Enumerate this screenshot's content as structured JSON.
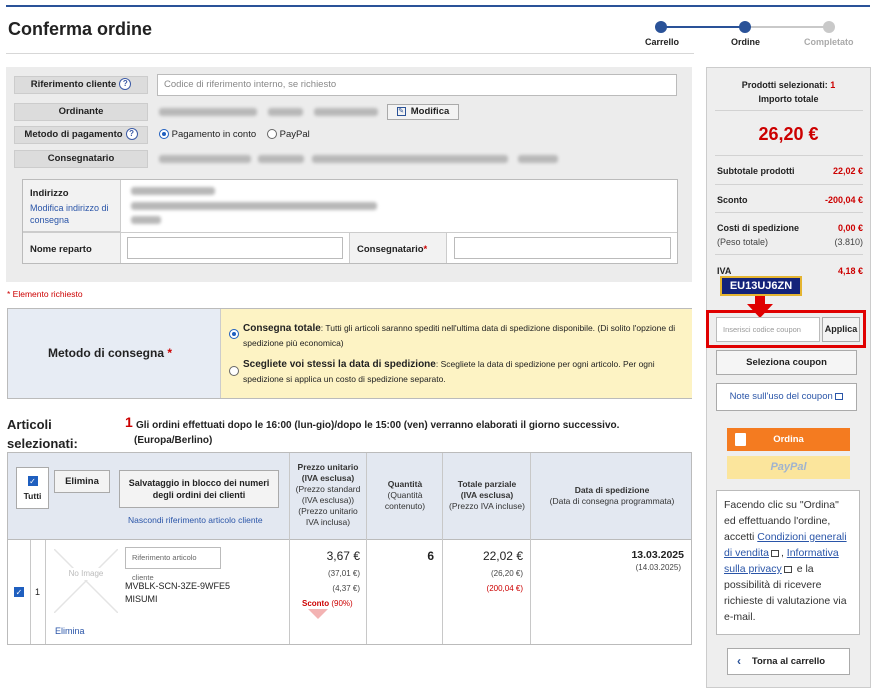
{
  "page": {
    "title": "Conferma ordine"
  },
  "steps": [
    {
      "label": "Carrello",
      "state": "done"
    },
    {
      "label": "Ordine",
      "state": "active"
    },
    {
      "label": "Completato",
      "state": "pending"
    }
  ],
  "form": {
    "customer_ref_label": "Riferimento cliente",
    "customer_ref_placeholder": "Codice di riferimento interno, se richiesto",
    "orderer_label": "Ordinante",
    "modify_label": "Modifica",
    "payment_label": "Metodo di pagamento",
    "payment_options": [
      "Pagamento in conto",
      "PayPal"
    ],
    "consignee_label": "Consegnatario",
    "address_label": "Indirizzo",
    "modify_address_link": "Modifica indirizzo di consegna",
    "department_label": "Nome reparto",
    "consignee_field_label": "Consegnatario",
    "required_mark": "*",
    "required_note": "* Elemento richiesto"
  },
  "delivery": {
    "label": "Metodo di consegna",
    "required_mark": "*",
    "option1_title": "Consegna totale",
    "option1_text": ": Tutti gli articoli saranno spediti nell'ultima data di spedizione disponibile. (Di solito l'opzione di spedizione più economica)",
    "option2_title": "Scegliete voi stessi la data di spedizione",
    "option2_text": ": Scegliete la data di spedizione per ogni articolo. Per ogni spedizione si applica un costo di spedizione separato."
  },
  "articles": {
    "title": "Articoli selezionati:",
    "notice_number": "1",
    "notice_text": "Gli ordini effettuati dopo le 16:00 (lun-gio)/dopo le 15:00 (ven) verranno elaborati il giorno successivo.",
    "notice_tz": "(Europa/Berlino)",
    "all_label": "Tutti",
    "delete_label": "Elimina",
    "bulk_save_label": "Salvataggio in blocco dei numeri degli ordini dei clienti",
    "hide_ref_link": "Nascondi riferimento articolo cliente",
    "headers": {
      "unit_price": "Prezzo unitario",
      "unit_price_sub1": "(IVA esclusa)",
      "unit_price_sub2": "(Prezzo standard (IVA esclusa))",
      "unit_price_sub3": "(Prezzo unitario IVA inclusa)",
      "quantity": "Quantità",
      "quantity_sub": "(Quantità contenuto)",
      "subtotal": "Totale parziale",
      "subtotal_sub1": "(IVA esclusa)",
      "subtotal_sub2": "(Prezzo IVA incluse)",
      "ship_date": "Data di spedizione",
      "ship_date_sub": "(Data di consegna programmata)"
    },
    "row": {
      "index": "1",
      "no_image": "No Image",
      "ref_placeholder": "Riferimento articolo cliente",
      "part_number": "MVBLK-SCN-3ZE-9WFE5",
      "brand": "MISUMI",
      "delete_link": "Elimina",
      "unit_price": "3,67 €",
      "standard_price": "(37,01 €)",
      "price_incl_vat": "(4,37 €)",
      "discount": "Sconto",
      "discount_pct": "(90%)",
      "quantity": "6",
      "subtotal": "22,02 €",
      "subtotal_incl": "(26,20 €)",
      "subtotal_discount": "(200,04 €)",
      "ship_date": "13.03.2025",
      "delivery_date": "(14.03.2025)"
    }
  },
  "summary": {
    "selected_label": "Prodotti selezionati:",
    "selected_count": "1",
    "total_label": "Importo totale",
    "total": "26,20 €",
    "subtotal_label": "Subtotale prodotti",
    "subtotal": "22,02 €",
    "discount_label": "Sconto",
    "discount": "-200,04 €",
    "shipping_label": "Costi di spedizione",
    "shipping": "0,00 €",
    "weight_label": "(Peso totale)",
    "weight": "(3.810)",
    "vat_label": "IVA",
    "vat": "4,18 €",
    "coupon_code": "EU13UJ6ZN",
    "coupon_placeholder": "Inserisci codice coupon",
    "apply_label": "Applica",
    "select_coupon_label": "Seleziona coupon",
    "coupon_note_label": "Note sull'uso del coupon",
    "order_label": "Ordina",
    "paypal_label": "PayPal",
    "terms_pre": "Facendo clic su \"Ordina\" ed effettuando l'ordine, accetti",
    "terms_link1": "Condizioni generali di vendita",
    "terms_link2": "Informativa sulla privacy",
    "terms_post": "e la possibilità di ricevere richieste di valutazione via e-mail.",
    "back_label": "Torna al carrello"
  },
  "colors": {
    "accent": "#2a5298",
    "red": "#cc0000",
    "orange": "#f47b20",
    "highlight": "#e00000"
  }
}
